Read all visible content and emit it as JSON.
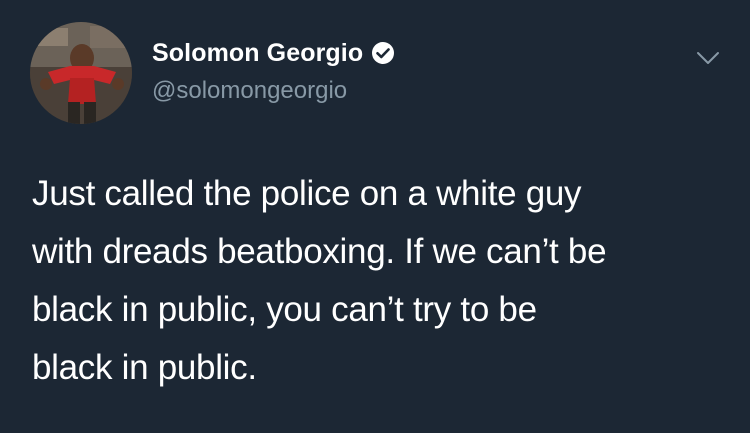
{
  "tweet": {
    "author": {
      "display_name": "Solomon Georgio",
      "handle": "@solomongeorgio",
      "verified": true
    },
    "text": "Just called the police on a white guy\nwith dreads beatboxing. If we can’t be\nblack in public, you can’t try to be\nblack in public."
  },
  "icons": {
    "verified": "verified-badge-icon",
    "menu": "chevron-down-icon"
  },
  "colors": {
    "background": "#1c2734",
    "text": "#ffffff",
    "secondary_text": "#8899a6",
    "caret": "#8899a6"
  }
}
